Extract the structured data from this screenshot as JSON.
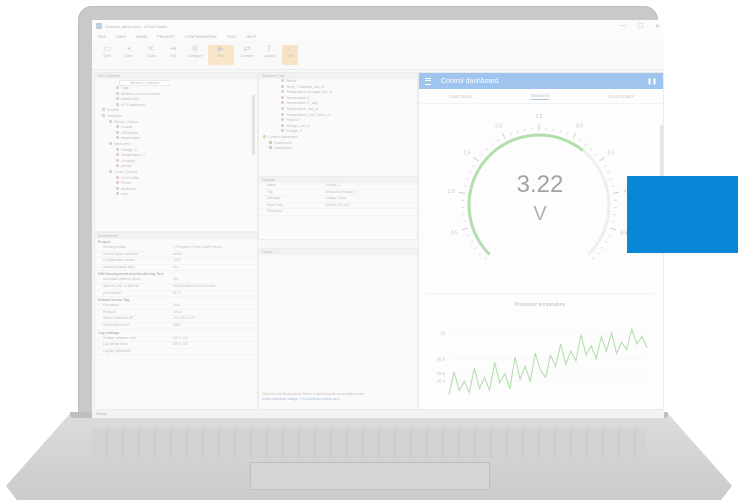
{
  "window": {
    "title": "Sensors_demo.mxe - InTact Studio",
    "controls": [
      "—",
      "☐",
      "✕"
    ]
  },
  "menubar": [
    "FILE",
    "VIEW",
    "HOME",
    "PROJECT",
    "CONFIGURATION",
    "TEST",
    "HELP"
  ],
  "toolbar": [
    {
      "label": "Open",
      "icon": "folder-icon"
    },
    {
      "label": "Save",
      "icon": "save-icon"
    },
    {
      "label": "Close",
      "icon": "close-icon"
    },
    {
      "label": "Exit",
      "icon": "exit-icon"
    },
    {
      "label": "Configure",
      "icon": "gear-icon"
    },
    {
      "label": "Run",
      "icon": "run-icon",
      "active": true
    },
    {
      "label": "Connect",
      "icon": "connect-icon"
    },
    {
      "label": "Upload",
      "icon": "upload-icon"
    },
    {
      "label": "Test",
      "icon": "test-icon",
      "active": true
    }
  ],
  "left_panel": {
    "header": "MCU Explorer",
    "search_value": "Sensors_Collector",
    "tree": [
      {
        "label": "Tags",
        "indent": 3,
        "kind": "sq"
      },
      {
        "label": "Modbus Communication",
        "indent": 3,
        "kind": "sq"
      },
      {
        "label": "Mobile App",
        "indent": 3,
        "kind": "sq"
      },
      {
        "label": "IoT Dashboard",
        "indent": 3,
        "kind": "sq"
      },
      {
        "label": "Models",
        "indent": 1,
        "kind": "sq"
      },
      {
        "label": "Variables",
        "indent": 1,
        "kind": "sq"
      },
      {
        "label": "Sensor_Status",
        "indent": 2,
        "kind": "sq"
      },
      {
        "label": "Counts",
        "indent": 3,
        "kind": "dot"
      },
      {
        "label": "LEDStatus",
        "indent": 3,
        "kind": "dot"
      },
      {
        "label": "temperature",
        "indent": 3,
        "kind": "dot"
      },
      {
        "label": "Measures",
        "indent": 2,
        "kind": "sq"
      },
      {
        "label": "Voltage_V",
        "indent": 3,
        "kind": "dot"
      },
      {
        "label": "Temperature_C",
        "indent": 3,
        "kind": "dot"
      },
      {
        "label": "Humidity",
        "indent": 3,
        "kind": "dot"
      },
      {
        "label": "pblock",
        "indent": 3,
        "kind": "dot"
      },
      {
        "label": "Count_Control",
        "indent": 2,
        "kind": "sq"
      },
      {
        "label": "LEDConfig",
        "indent": 3,
        "kind": "dot"
      },
      {
        "label": "Period",
        "indent": 3,
        "kind": "dot"
      },
      {
        "label": "Attributes",
        "indent": 3,
        "kind": "dot"
      },
      {
        "label": "bool",
        "indent": 3,
        "kind": "dot"
      }
    ]
  },
  "properties_panel": {
    "header": "Environment",
    "groups": [
      {
        "name": "Project",
        "rows": [
          [
            "Working Folder",
            "C:\\Program Files\\InTact\\Projects"
          ],
          [
            "Current active operator",
            "admin"
          ],
          [
            "Configuration version",
            "1023"
          ],
          [
            "Shared network drive",
            "No"
          ]
        ]
      },
      {
        "name": "NMI Development and Monitoring Tool",
        "rows": [
          [
            "Automatic Refresh group",
            "Yes"
          ],
          [
            "Web-IIS URL or NMI file",
            "http://localhost:8170/monitor"
          ],
          [
            "port number",
            "8170"
          ]
        ]
      },
      {
        "name": "Default Server Tag",
        "rows": [
          [
            "Encryption",
            "Auto"
          ],
          [
            "Protocol",
            "Serial"
          ],
          [
            "Server hostname/IP",
            "192.168.0.178"
          ],
          [
            "Server listen Port",
            "5080"
          ]
        ]
      },
      {
        "name": "Log settings",
        "rows": [
          [
            "Disable software level",
            "INFO_OE"
          ],
          [
            "Log device level",
            "INFO_OE"
          ],
          [
            "Log file path/name",
            ""
          ]
        ]
      }
    ]
  },
  "middle_panel": {
    "header": "Resource Tree",
    "tree": [
      "Period",
      "Temp_Timestate_std_ct",
      "Temperature Average_std_ct",
      "Temperature C",
      "Temperature C_avg",
      "Temperature_std_ct",
      "Temperature_Cal_Count_ct",
      "Trend ct",
      "Voltage_std_ct",
      "Voltage_V"
    ],
    "sub_items": [
      "Control dashboard",
      "Dashboard",
      "Dashboard"
    ],
    "props_header": "Variable",
    "props": [
      [
        "Name",
        "Voltage_V"
      ],
      [
        "Tag",
        "/Measures/Voltage_V"
      ],
      [
        "Datatype",
        "Voltage Status"
      ],
      [
        "Read Only",
        "Missed (2/1 ms)"
      ],
      [
        "Recorded",
        ""
      ]
    ],
    "output_header": "Output",
    "output_lines": [
      "Output for last Development Server & Monitoring file successfully loaded",
      "Added measured Voltage_V to Dashboard status panel"
    ]
  },
  "dashboard": {
    "title": "Control dashboard",
    "tabs": [
      "Count Status",
      "Measures",
      "Count Control"
    ],
    "active_tab": 1,
    "gauge": {
      "value": 3.22,
      "value_text": "3.22",
      "unit": "V",
      "min": 0,
      "max": 5,
      "tick_labels": [
        "0.0",
        "0.5",
        "1.0",
        "1.5",
        "2.0",
        "2.5",
        "3.0",
        "3.5",
        "4.0",
        "4.5",
        "5.0"
      ],
      "arc_color": "#8fcf86"
    },
    "chart_data": {
      "type": "line",
      "title": "Processor temperature",
      "ylabel": "",
      "xlabel": "",
      "y_ticks": [
        "28",
        "26.6",
        "25.8",
        "25.4"
      ],
      "ylim": [
        24.6,
        28.8
      ],
      "values": [
        24.7,
        25.9,
        24.9,
        25.4,
        24.8,
        26.1,
        25.0,
        25.6,
        24.9,
        26.4,
        25.3,
        25.8,
        25.0,
        26.7,
        25.5,
        26.2,
        25.4,
        26.9,
        26.0,
        25.6,
        26.8,
        26.2,
        27.4,
        26.3,
        27.0,
        26.5,
        27.9,
        26.8,
        27.3,
        26.6,
        27.8,
        27.0,
        28.0,
        26.9,
        27.5,
        27.1,
        28.2,
        27.4,
        27.8,
        27.2
      ],
      "line_color": "#8fcf86"
    }
  },
  "statusbar": "Ready",
  "overlay": {
    "color": "#0a86d6"
  }
}
